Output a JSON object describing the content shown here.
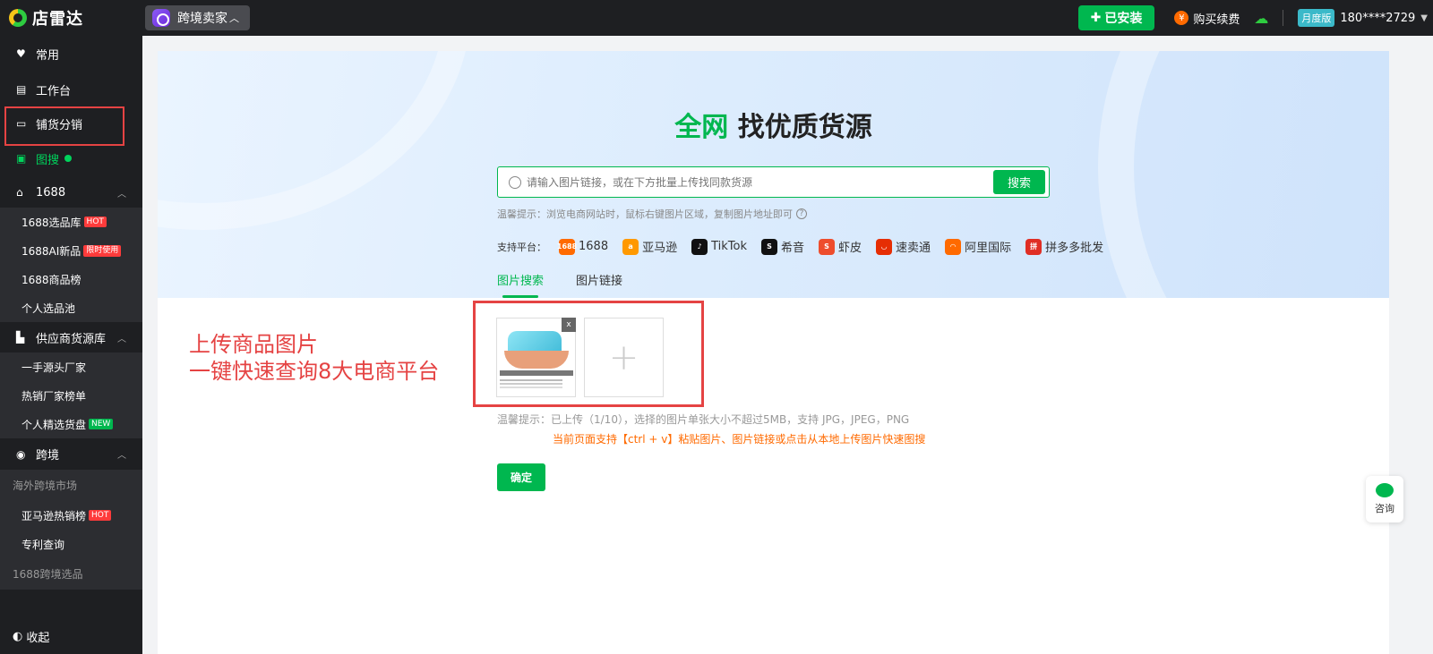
{
  "topbar": {
    "logo_text": "店雷达",
    "mode_label": "跨境卖家",
    "install_label": "已安装",
    "buy_label": "购买续费",
    "badge_label": "月度版",
    "phone": "180****2729"
  },
  "sidebar": {
    "top_items": [
      {
        "label": "常用",
        "icon": "heart-icon"
      },
      {
        "label": "工作台",
        "icon": "book-icon"
      },
      {
        "label": "铺货分销",
        "icon": "list-icon"
      },
      {
        "label": "图搜",
        "icon": "image-icon"
      }
    ],
    "groups": {
      "g1688": {
        "label": "1688",
        "items": [
          {
            "label": "1688选品库",
            "tag": "HOT"
          },
          {
            "label": "1688AI新品",
            "tag": "限时使用"
          },
          {
            "label": "1688商品榜",
            "tag": ""
          },
          {
            "label": "个人选品池",
            "tag": ""
          }
        ]
      },
      "supply": {
        "label": "供应商货源库",
        "items": [
          {
            "label": "一手源头厂家",
            "tag": ""
          },
          {
            "label": "热销厂家榜单",
            "tag": ""
          },
          {
            "label": "个人精选货盘",
            "tag": "NEW"
          }
        ]
      },
      "cross": {
        "label": "跨境",
        "category1": "海外跨境市场",
        "items": [
          {
            "label": "亚马逊热销榜",
            "tag": "HOT"
          },
          {
            "label": "专利查询",
            "tag": ""
          }
        ],
        "category2": "1688跨境选品"
      }
    },
    "collapse_label": "收起"
  },
  "hero": {
    "title_accent": "全网",
    "title_rest": " 找优质货源",
    "search_placeholder": "请输入图片链接，或在下方批量上传找同款货源",
    "search_button": "搜索",
    "tip": "温馨提示：浏览电商网站时，鼠标右键图片区域，复制图片地址即可",
    "platforms_label": "支持平台：",
    "platforms": [
      {
        "name": "1688",
        "color": "#ff6a00",
        "icon": "1688-icon"
      },
      {
        "name": "亚马逊",
        "color": "#ff9900",
        "icon": "amazon-icon"
      },
      {
        "name": "TikTok",
        "color": "#111111",
        "icon": "tiktok-icon"
      },
      {
        "name": "希音",
        "color": "#111111",
        "icon": "shein-icon"
      },
      {
        "name": "虾皮",
        "color": "#ee4d2d",
        "icon": "shopee-icon"
      },
      {
        "name": "速卖通",
        "color": "#e62e04",
        "icon": "aliexpress-icon"
      },
      {
        "name": "阿里国际",
        "color": "#ff6a00",
        "icon": "alibaba-icon"
      },
      {
        "name": "拼多多批发",
        "color": "#e02e24",
        "icon": "pinduoduo-icon"
      }
    ],
    "tabs": [
      "图片搜索",
      "图片链接"
    ]
  },
  "upload": {
    "annotation_line1": "上传商品图片",
    "annotation_line2": "一键快速查询8大电商平台",
    "delete_label": "x",
    "tip": "温馨提示：已上传（1/10），选择的图片单张大小不超过5MB，支持 JPG，JPEG，PNG",
    "hint": "当前页面支持【ctrl + v】粘贴图片、图片链接或点击从本地上传图片快速图搜",
    "confirm_label": "确定"
  },
  "consult_label": "咨询",
  "colors": {
    "accent": "#00b74f",
    "annotation_red": "#e54343",
    "hint_orange": "#ff6a00",
    "dark_bg": "#1e1f22"
  }
}
